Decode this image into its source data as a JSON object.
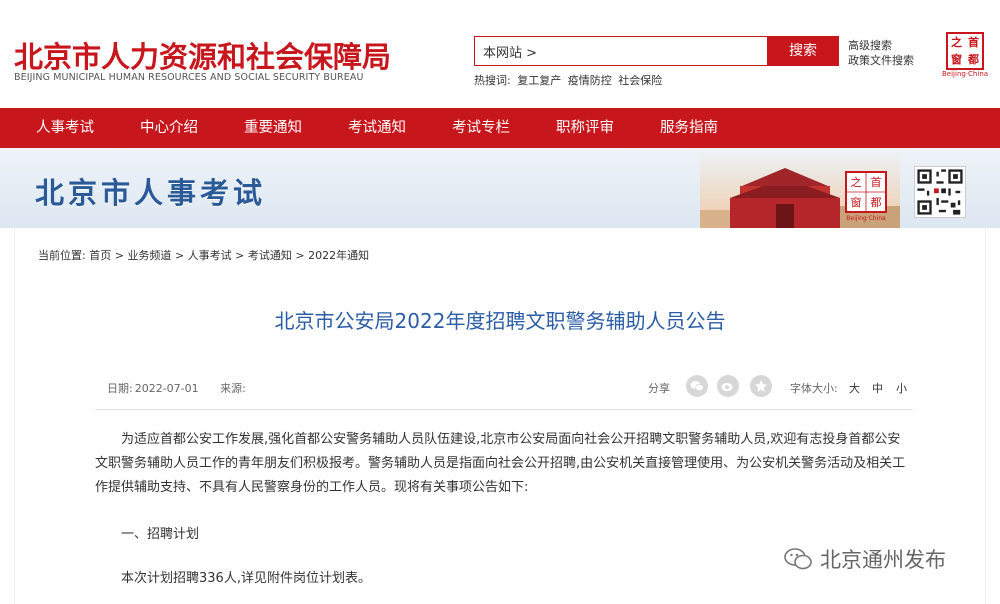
{
  "header": {
    "logo_cn": "北京市人力资源和社会保障局",
    "logo_en": "BEIJING MUNICIPAL HUMAN RESOURCES AND SOCIAL SECURITY BUREAU",
    "search_value": "本网站 >",
    "search_button": "搜索",
    "advanced_search": "高级搜索",
    "policy_search": "政策文件搜索",
    "hot_label": "热搜词:",
    "hot_terms": [
      "复工复产",
      "疫情防控",
      "社会保险"
    ],
    "seal_chars": [
      "之",
      "首",
      "窗",
      "都"
    ],
    "seal_caption": "Beijing·China"
  },
  "nav": {
    "items": [
      "人事考试",
      "中心介绍",
      "重要通知",
      "考试通知",
      "考试专栏",
      "职称评审",
      "服务指南"
    ]
  },
  "banner": {
    "title": "北京市人事考试",
    "seal_chars": [
      "之",
      "首",
      "窗",
      "都"
    ],
    "seal_caption": "Beijing·China"
  },
  "breadcrumb": {
    "label": "当前位置:",
    "items": [
      "首页",
      "业务频道",
      "人事考试",
      "考试通知",
      "2022年通知"
    ],
    "separator": ">"
  },
  "article": {
    "title": "北京市公安局2022年度招聘文职警务辅助人员公告",
    "date_label": "日期:",
    "date": "2022-07-01",
    "source_label": "来源:",
    "share_label": "分享",
    "font_size_label": "字体大小:",
    "font_sizes": [
      "大",
      "中",
      "小"
    ],
    "paragraph_1": "为适应首都公安工作发展,强化首都公安警务辅助人员队伍建设,北京市公安局面向社会公开招聘文职警务辅助人员,欢迎有志投身首都公安文职警务辅助人员工作的青年朋友们积极报考。警务辅助人员是指面向社会公开招聘,由公安机关直接管理使用、为公安机关警务活动及相关工作提供辅助支持、不具有人民警察身份的工作人员。现将有关事项公告如下:",
    "section_1": "一、招聘计划",
    "paragraph_2": "本次计划招聘336人,详见附件岗位计划表。"
  },
  "watermark": {
    "text": "北京通州发布"
  },
  "colors": {
    "brand_red": "#c8161d",
    "title_blue": "#2b5da7",
    "banner_blue": "#2a5a97"
  }
}
